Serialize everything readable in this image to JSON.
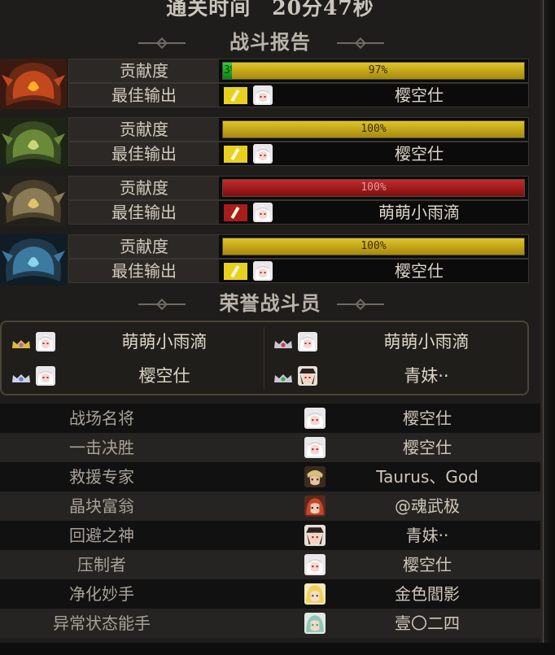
{
  "header": {
    "clear_time": "通关时间　20分47秒"
  },
  "report": {
    "title": "战斗报告",
    "contribution_label": "贡献度",
    "best_output_label": "最佳输出",
    "bosses": [
      {
        "theme": "fire",
        "share": [
          3,
          97
        ],
        "share_labels": [
          "3%",
          "97%"
        ],
        "bar_colors": [
          "#1fbf2e",
          "#d0b41e"
        ],
        "best_player": "樱空仕",
        "damage_icon_color": "#e8d11e"
      },
      {
        "theme": "green",
        "share": [
          100
        ],
        "share_labels": [
          "100%"
        ],
        "bar_colors": [
          "#d0b41e"
        ],
        "best_player": "樱空仕",
        "damage_icon_color": "#e8d11e"
      },
      {
        "theme": "gold",
        "share": [
          100
        ],
        "share_labels": [
          "100%"
        ],
        "bar_colors": [
          "#a81c1c"
        ],
        "best_player": "萌萌小雨滴",
        "damage_icon_color": "#a81c1c"
      },
      {
        "theme": "blue",
        "share": [
          100
        ],
        "share_labels": [
          "100%"
        ],
        "bar_colors": [
          "#d0b41e"
        ],
        "best_player": "樱空仕",
        "damage_icon_color": "#e8d11e"
      }
    ]
  },
  "honor": {
    "title": "荣誉战斗员",
    "members": [
      {
        "name": "萌萌小雨滴",
        "badge": "crown-gold-badge"
      },
      {
        "name": "萌萌小雨滴",
        "badge": "crown-red-badge"
      },
      {
        "name": "樱空仕",
        "badge": "crown-silver-badge"
      },
      {
        "name": "青妹··",
        "badge": "crown-green-badge"
      }
    ]
  },
  "awards": [
    {
      "title": "战场名将",
      "player": "樱空仕",
      "avatar": "white-hair-avatar"
    },
    {
      "title": "一击决胜",
      "player": "樱空仕",
      "avatar": "white-hair-avatar"
    },
    {
      "title": "救援专家",
      "player": "Taurus、God",
      "avatar": "brown-hair-avatar"
    },
    {
      "title": "晶块富翁",
      "player": "@魂武极",
      "avatar": "red-hair-avatar"
    },
    {
      "title": "回避之神",
      "player": "青妹··",
      "avatar": "hat-avatar"
    },
    {
      "title": "压制者",
      "player": "樱空仕",
      "avatar": "white-hair-avatar"
    },
    {
      "title": "净化妙手",
      "player": "金色閻影",
      "avatar": "blonde-avatar"
    },
    {
      "title": "异常状态能手",
      "player": "壹〇二四",
      "avatar": "teal-hair-avatar"
    }
  ]
}
